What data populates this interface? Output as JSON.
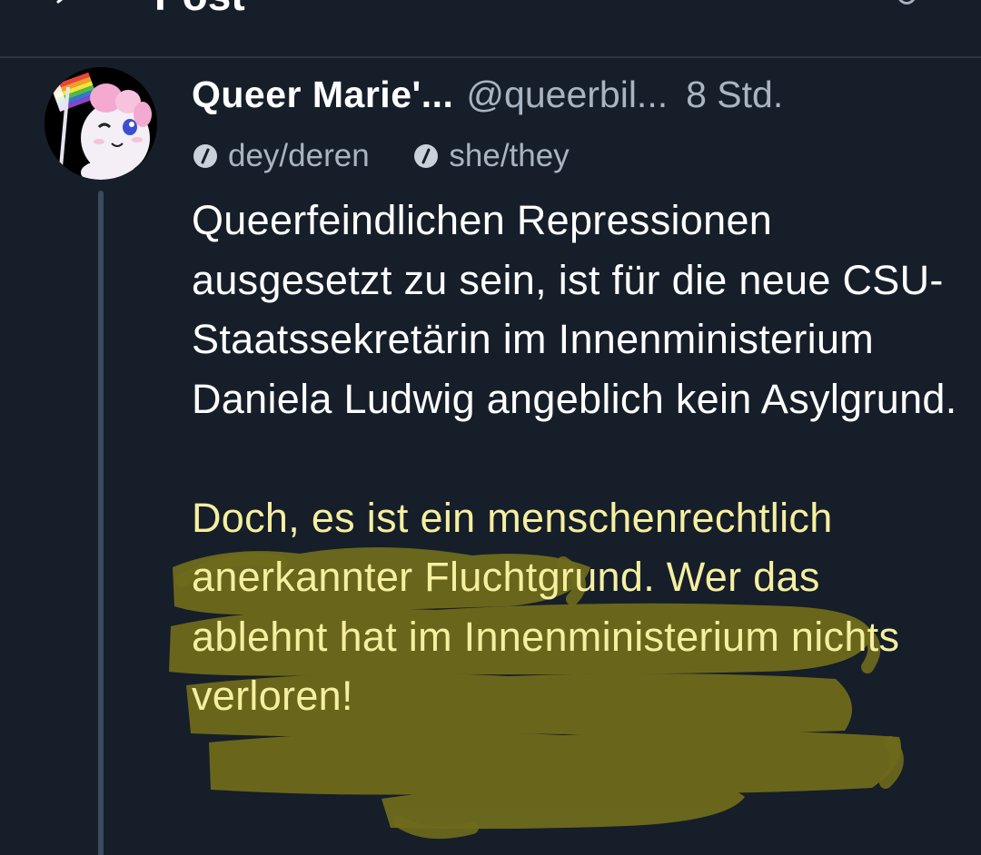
{
  "header": {
    "title": "Post",
    "right_glyph": "↻"
  },
  "post": {
    "author": {
      "display_name": "Queer Marie'...",
      "handle": "@queerbil...",
      "time": "8 Std."
    },
    "pronouns": [
      {
        "label": "dey/deren"
      },
      {
        "label": "she/they"
      }
    ],
    "text": {
      "paragraph_1": "Queerfeindlichen Repressionen ausgesetzt zu sein, ist für die neue CSU-Staatssekretärin im Innenministerium Daniela Ludwig angeblich kein Asylgrund.",
      "paragraph_2": "Doch, es ist ein menschenrechtlich anerkannter Fluchtgrund. Wer das ablehnt hat im Innenministerium nichts verloren!"
    }
  },
  "colors": {
    "background": "#161e29",
    "text_primary": "#ffffff",
    "text_secondary": "#a9b4c2",
    "highlight_marker": "#6e6a1c",
    "highlighted_text": "#f5efa0",
    "thread_line": "#3a4a5f"
  },
  "icons": {
    "back": "arrow-left-icon",
    "pronoun": "info-slash-icon"
  }
}
